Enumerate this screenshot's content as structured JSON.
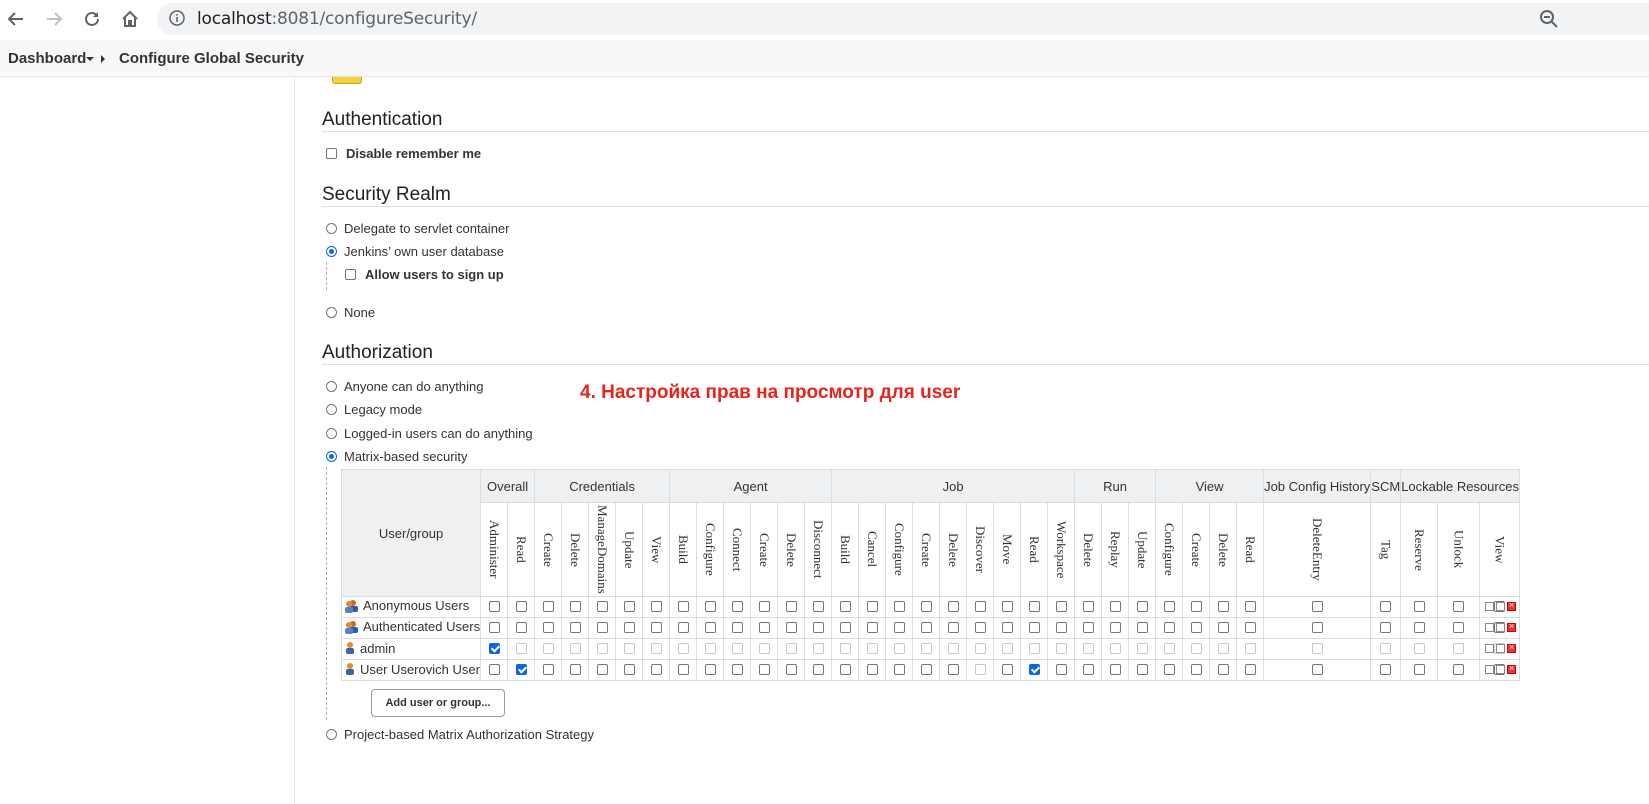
{
  "browser": {
    "url_host": "localhost",
    "url_path": ":8081/configureSecurity/"
  },
  "breadcrumb": {
    "dashboard": "Dashboard",
    "current": "Configure Global Security"
  },
  "sections": {
    "authentication": {
      "title": "Authentication",
      "disable_remember_me": {
        "label": "Disable remember me",
        "checked": false
      }
    },
    "security_realm": {
      "title": "Security Realm",
      "options": [
        {
          "label": "Delegate to servlet container",
          "selected": false
        },
        {
          "label": "Jenkins’ own user database",
          "selected": true
        },
        {
          "label": "None",
          "selected": false
        }
      ],
      "allow_signup": {
        "label": "Allow users to sign up",
        "checked": false
      }
    },
    "authorization": {
      "title": "Authorization",
      "options": [
        {
          "label": "Anyone can do anything",
          "selected": false
        },
        {
          "label": "Legacy mode",
          "selected": false
        },
        {
          "label": "Logged-in users can do anything",
          "selected": false
        },
        {
          "label": "Matrix-based security",
          "selected": true
        },
        {
          "label": "Project-based Matrix Authorization Strategy",
          "selected": false
        }
      ]
    }
  },
  "annotation": "4. Настройка прав на просмотр для user",
  "matrix": {
    "user_group_header": "User/group",
    "groups": [
      {
        "name": "Overall",
        "perms": [
          "Administer",
          "Read"
        ]
      },
      {
        "name": "Credentials",
        "perms": [
          "Create",
          "Delete",
          "ManageDomains",
          "Update",
          "View"
        ]
      },
      {
        "name": "Agent",
        "perms": [
          "Build",
          "Configure",
          "Connect",
          "Create",
          "Delete",
          "Disconnect"
        ]
      },
      {
        "name": "Job",
        "perms": [
          "Build",
          "Cancel",
          "Configure",
          "Create",
          "Delete",
          "Discover",
          "Move",
          "Read",
          "Workspace"
        ]
      },
      {
        "name": "Run",
        "perms": [
          "Delete",
          "Replay",
          "Update"
        ]
      },
      {
        "name": "View",
        "perms": [
          "Configure",
          "Create",
          "Delete",
          "Read"
        ]
      },
      {
        "name": "Job Config History",
        "perms": [
          "DeleteEntry"
        ]
      },
      {
        "name": "SCM",
        "perms": [
          "Tag"
        ]
      },
      {
        "name": "Lockable Resources",
        "perms": [
          "Reserve",
          "Unlock",
          "View"
        ]
      }
    ],
    "rows": [
      {
        "name": "Anonymous Users",
        "icon": "group-icon",
        "checked": [],
        "disabled": []
      },
      {
        "name": "Authenticated Users",
        "icon": "group-icon",
        "checked": [],
        "disabled": []
      },
      {
        "name": "admin",
        "icon": "user-icon",
        "checked": [
          0
        ],
        "disabled": "all-but-0"
      },
      {
        "name": "User Userovich User",
        "icon": "user-icon",
        "checked": [
          1,
          20
        ],
        "disabled": [
          18
        ]
      }
    ],
    "add_button": "Add user or group..."
  },
  "colors": {
    "accent": "#0b66e4",
    "annotation": "#e8231b",
    "header_bg": "#eef0f2"
  }
}
